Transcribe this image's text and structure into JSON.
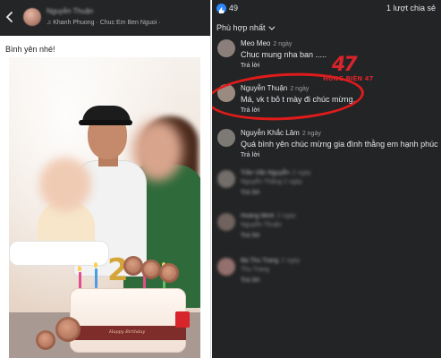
{
  "post": {
    "author_name": "Nguyễn Thuận",
    "song_line": "♫ Khanh Phuong · Chuc Em Ben Nguoi ·",
    "caption": "Bình yên nhé!",
    "cake_band_text": "Happy Birthday",
    "cake_number": "2"
  },
  "stats": {
    "like_count": "49",
    "share_count": "1 lượt chia sẻ"
  },
  "sort": {
    "label": "Phù hợp nhất"
  },
  "comments": [
    {
      "name": "Meo Meo",
      "time": "2 ngày",
      "text": "Chuc mung nha ban .....",
      "reply": "Trả lời"
    },
    {
      "name": "Nguyễn Thuận",
      "time": "2 ngày",
      "text": "Má, vk t bỏ t mày đi chúc mừng.",
      "reply": "Trả lời"
    },
    {
      "name": "Nguyễn Khắc Lâm",
      "time": "2 ngày",
      "text": "Quá bình yên chúc mừng gia đình thằng em hạnh phúc",
      "reply": "Trả lời"
    },
    {
      "name": "Trần Văn Nguyễn",
      "time": "2 ngày",
      "text": "Nguyễn Thắng 2 ngày",
      "reply": "Trả lời"
    },
    {
      "name": "Hoàng Minh",
      "time": "2 ngày",
      "text": "Nguyễn Thuận",
      "reply": "Trả lời"
    },
    {
      "name": "Bà Thu Trang",
      "time": "2 ngày",
      "text": "Thu Trang",
      "reply": "Trả lời"
    }
  ],
  "watermark": {
    "mark": "47",
    "text": "HÙNG BIÊN 47"
  },
  "colors": {
    "highlight": "#e01b1b",
    "like_blue": "#2d88ff",
    "panel_dark": "#232425"
  },
  "icons": [
    "back-arrow-icon",
    "music-note-icon",
    "like-icon",
    "chevron-down-icon"
  ]
}
